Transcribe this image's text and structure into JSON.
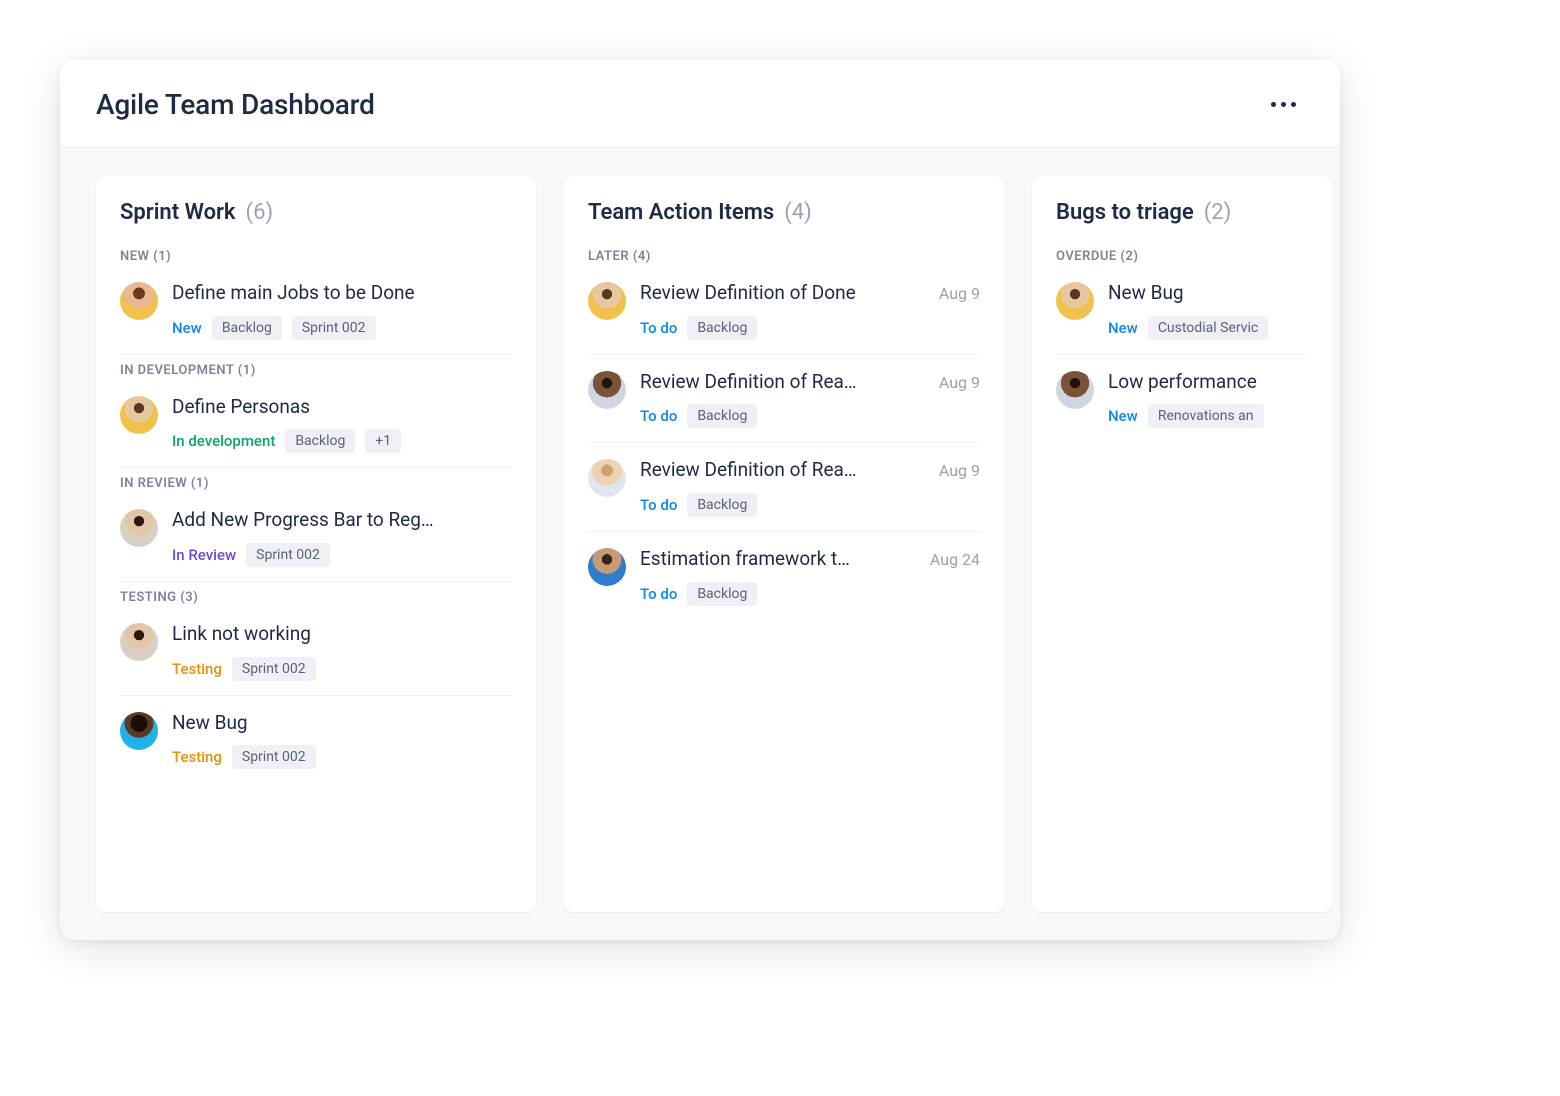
{
  "header": {
    "title": "Agile Team Dashboard"
  },
  "avatars": {
    "a1": "radial-gradient(circle at 50% 30%, #6b3a1e 0 18%, #e8b892 18% 46%, #f0c24b 46% 100%)",
    "a2": "radial-gradient(circle at 50% 32%, #5a3a1e 0 16%, #e7c7a0 16% 44%, #f0c24b 44% 100%)",
    "a3": "radial-gradient(circle at 50% 32%, #2a1a0f 0 16%, #e2c6a8 16% 44%, #d9d0c4 44% 100%)",
    "a4": "radial-gradient(circle at 50% 30%, #1a0e07 0 26%, #5a3a23 26% 44%, #21b1e8 44% 100%)",
    "a5": "radial-gradient(circle at 50% 32%, #1f120a 0 16%, #7a5238 16% 44%, #cfd6df 44% 100%)",
    "a6": "radial-gradient(circle at 50% 30%, #caa46a 0 18%, #efd2b2 18% 46%, #dfe6ee 46% 100%)",
    "a7": "radial-gradient(circle at 50% 30%, #3a2416 0 16%, #c79a74 16% 44%, #2f7dcf 44% 100%)"
  },
  "columns": [
    {
      "title": "Sprint Work",
      "count": "(6)",
      "sections": [
        {
          "label": "NEW (1)",
          "cards": [
            {
              "avatar": "a1",
              "title": "Define main Jobs to be Done",
              "status": [
                "new",
                "New"
              ],
              "pills": [
                "Backlog",
                "Sprint 002"
              ]
            }
          ]
        },
        {
          "label": "IN DEVELOPMENT (1)",
          "cards": [
            {
              "avatar": "a2",
              "title": "Define Personas",
              "status": [
                "indev",
                "In development"
              ],
              "pills": [
                "Backlog",
                "+1"
              ]
            }
          ]
        },
        {
          "label": "IN REVIEW (1)",
          "cards": [
            {
              "avatar": "a3",
              "title": "Add New Progress Bar to Reg…",
              "status": [
                "inreview",
                "In Review"
              ],
              "pills": [
                "Sprint 002"
              ]
            }
          ]
        },
        {
          "label": "TESTING (3)",
          "cards": [
            {
              "avatar": "a3",
              "title": "Link not working",
              "status": [
                "testing",
                "Testing"
              ],
              "pills": [
                "Sprint 002"
              ]
            },
            {
              "avatar": "a4",
              "title": "New Bug",
              "status": [
                "testing",
                "Testing"
              ],
              "pills": [
                "Sprint 002"
              ],
              "indent": false
            }
          ]
        }
      ]
    },
    {
      "title": "Team Action Items",
      "count": "(4)",
      "sections": [
        {
          "label": "LATER (4)",
          "cards": [
            {
              "avatar": "a2",
              "title": "Review Definition of Done",
              "date": "Aug 9",
              "status": [
                "todo",
                "To do"
              ],
              "pills": [
                "Backlog"
              ]
            },
            {
              "avatar": "a5",
              "title": "Review Definition of Rea…",
              "date": "Aug 9",
              "status": [
                "todo",
                "To do"
              ],
              "pills": [
                "Backlog"
              ]
            },
            {
              "avatar": "a6",
              "title": "Review Definition of Rea…",
              "date": "Aug 9",
              "status": [
                "todo",
                "To do"
              ],
              "pills": [
                "Backlog"
              ]
            },
            {
              "avatar": "a7",
              "title": "Estimation framework t…",
              "date": "Aug 24",
              "status": [
                "todo",
                "To do"
              ],
              "pills": [
                "Backlog"
              ]
            }
          ]
        }
      ]
    },
    {
      "title": "Bugs to triage",
      "count": "(2)",
      "sections": [
        {
          "label": "OVERDUE (2)",
          "cards": [
            {
              "avatar": "a2",
              "title": "New Bug",
              "status": [
                "new",
                "New"
              ],
              "pills": [
                "Custodial Servic"
              ]
            },
            {
              "avatar": "a5",
              "title": "Low performance",
              "status": [
                "new",
                "New"
              ],
              "pills": [
                "Renovations an"
              ]
            }
          ]
        }
      ]
    }
  ]
}
